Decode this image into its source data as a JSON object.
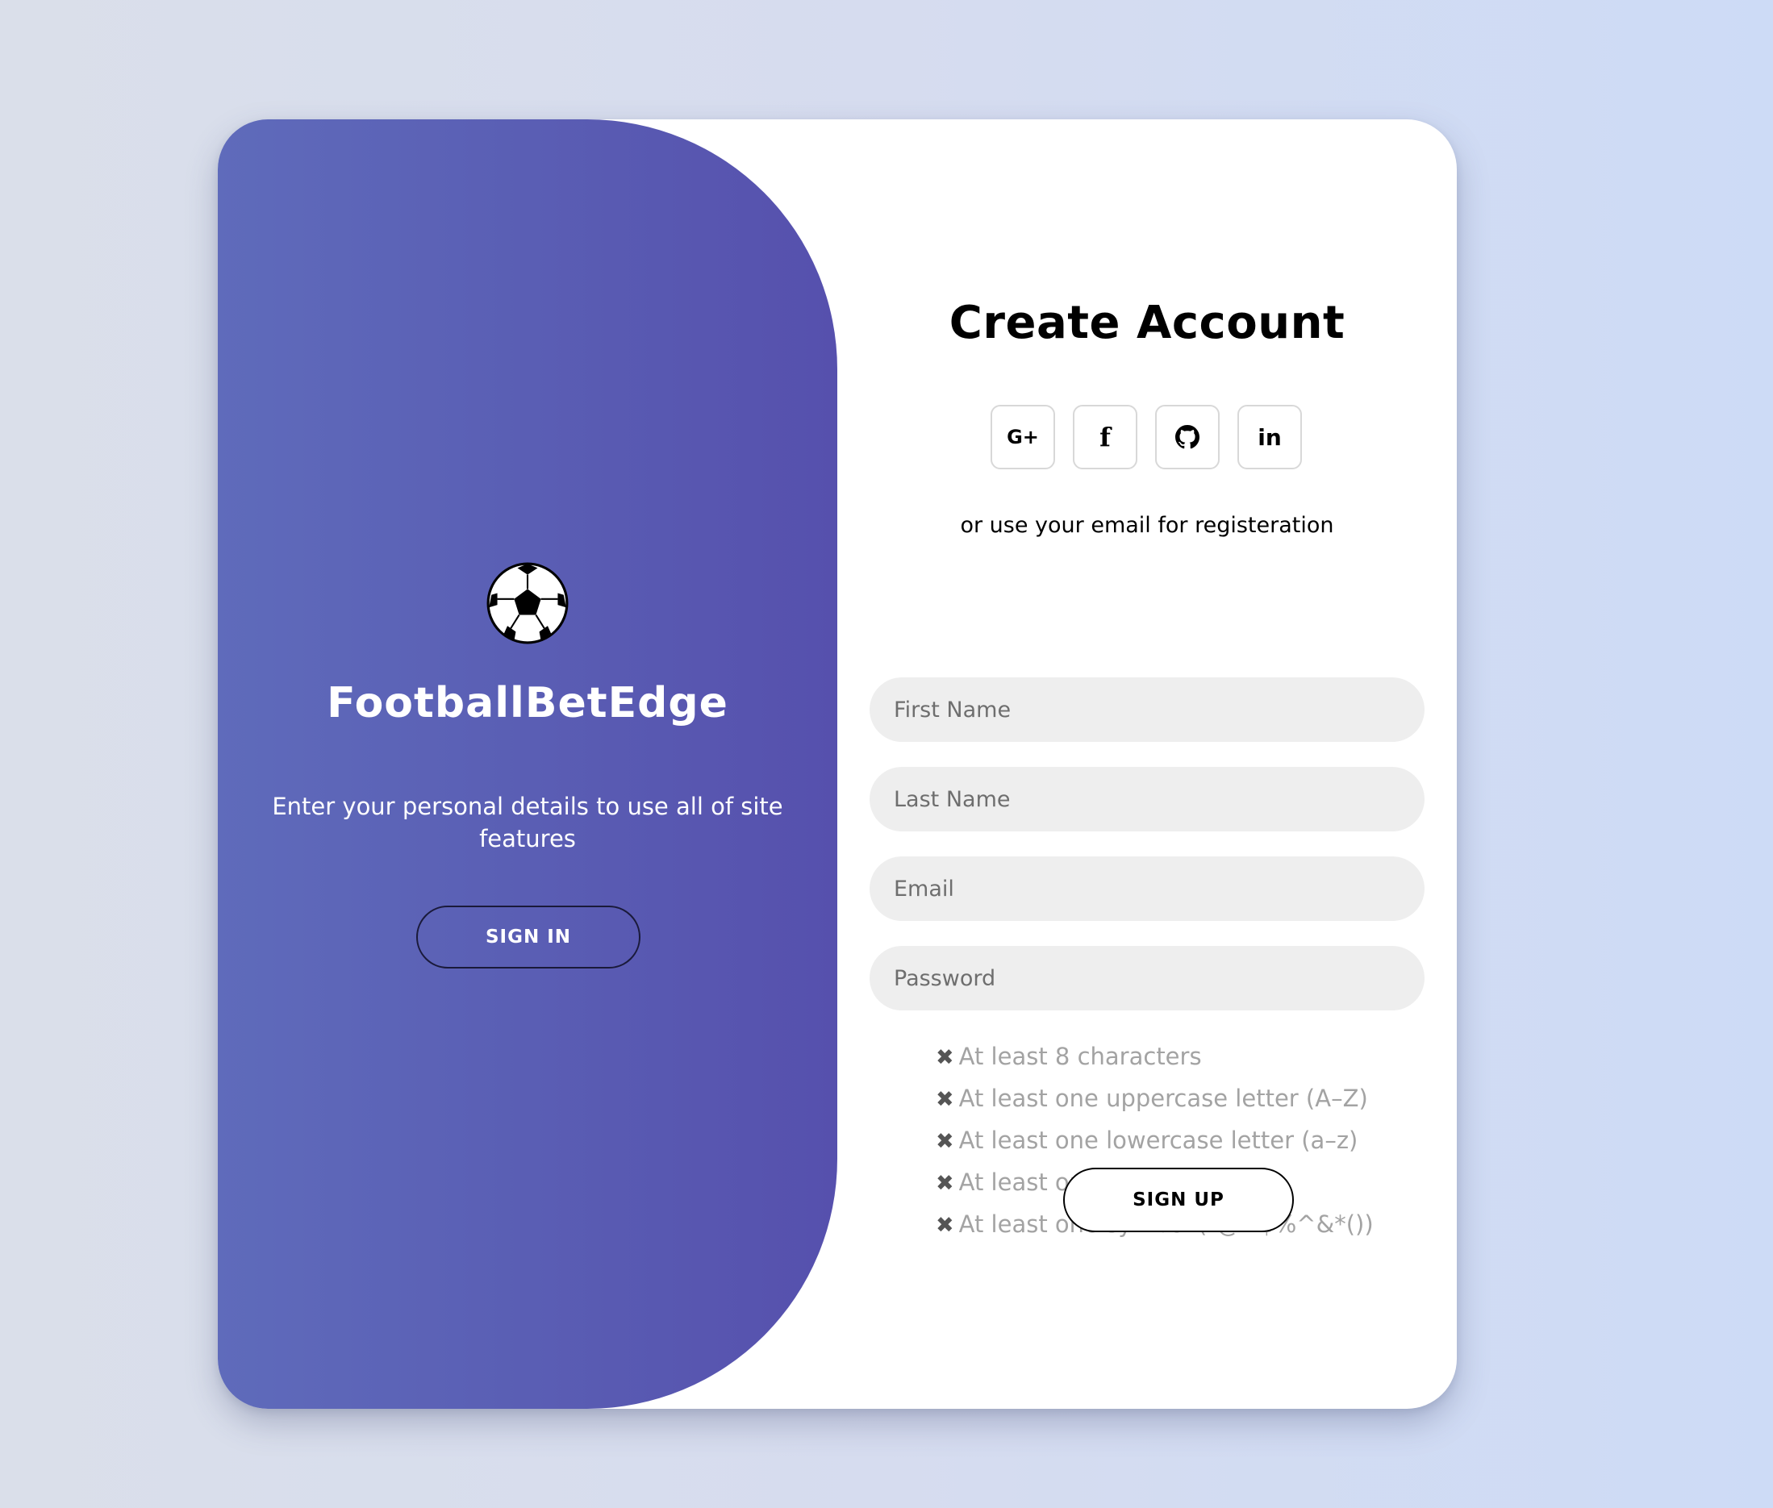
{
  "colors": {
    "panel_gradient_start": "#5f6bbb",
    "panel_gradient_end": "#5650ad",
    "input_background": "#eeeeee",
    "rule_text": "#a3a3a3"
  },
  "left": {
    "icon": "soccer-ball-icon",
    "brand": "FootballBetEdge",
    "tagline": "Enter your personal details to use all of site features",
    "sign_in_label": "SIGN IN"
  },
  "right": {
    "title": "Create Account",
    "socials": [
      {
        "icon": "google-plus-icon",
        "label": "G+"
      },
      {
        "icon": "facebook-icon",
        "label": "f"
      },
      {
        "icon": "github-icon",
        "label": ""
      },
      {
        "icon": "linkedin-icon",
        "label": "in"
      }
    ],
    "or_text": "or use your email for registeration",
    "fields": {
      "first_name": {
        "placeholder": "First Name",
        "value": ""
      },
      "last_name": {
        "placeholder": "Last Name",
        "value": ""
      },
      "email": {
        "placeholder": "Email",
        "value": ""
      },
      "password": {
        "placeholder": "Password",
        "value": ""
      }
    },
    "password_rules": [
      "At least 8 characters",
      "At least one uppercase letter (A–Z)",
      "At least one lowercase letter (a–z)",
      "At least one number (0–9)",
      "At least one symbol (!@#$%^&*())"
    ],
    "rule_status_icon": "cross-icon",
    "sign_up_label": "SIGN UP"
  }
}
